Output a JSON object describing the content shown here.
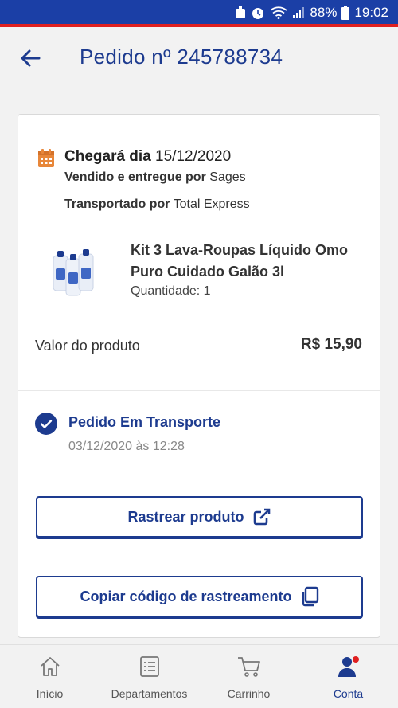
{
  "status_bar": {
    "battery": "88%",
    "time": "19:02"
  },
  "header": {
    "title": "Pedido nº 245788734"
  },
  "delivery": {
    "arrival_prefix": "Chegará dia",
    "arrival_date": "15/12/2020",
    "sold_by_label": "Vendido e entregue por",
    "sold_by": "Sages",
    "shipped_by_label": "Transportado por",
    "shipped_by": "Total Express"
  },
  "product": {
    "name": "Kit 3 Lava-Roupas Líquido Omo Puro Cuidado Galão 3l",
    "quantity": "Quantidade: 1",
    "value_label": "Valor do produto",
    "value": "R$ 15,90"
  },
  "order_status": {
    "title": "Pedido Em Transporte",
    "date": "03/12/2020 às 12:28"
  },
  "buttons": {
    "track": "Rastrear produto",
    "copy": "Copiar código de rastreamento"
  },
  "bottom_nav": {
    "items": [
      {
        "label": "Início",
        "icon": "home-icon"
      },
      {
        "label": "Departamentos",
        "icon": "list-icon"
      },
      {
        "label": "Carrinho",
        "icon": "cart-icon"
      },
      {
        "label": "Conta",
        "icon": "account-icon",
        "active": true
      }
    ]
  },
  "colors": {
    "primary": "#1d3b8f",
    "status_bar": "#1b3fa6",
    "accent_red": "#e02020",
    "calendar": "#e8873a"
  }
}
